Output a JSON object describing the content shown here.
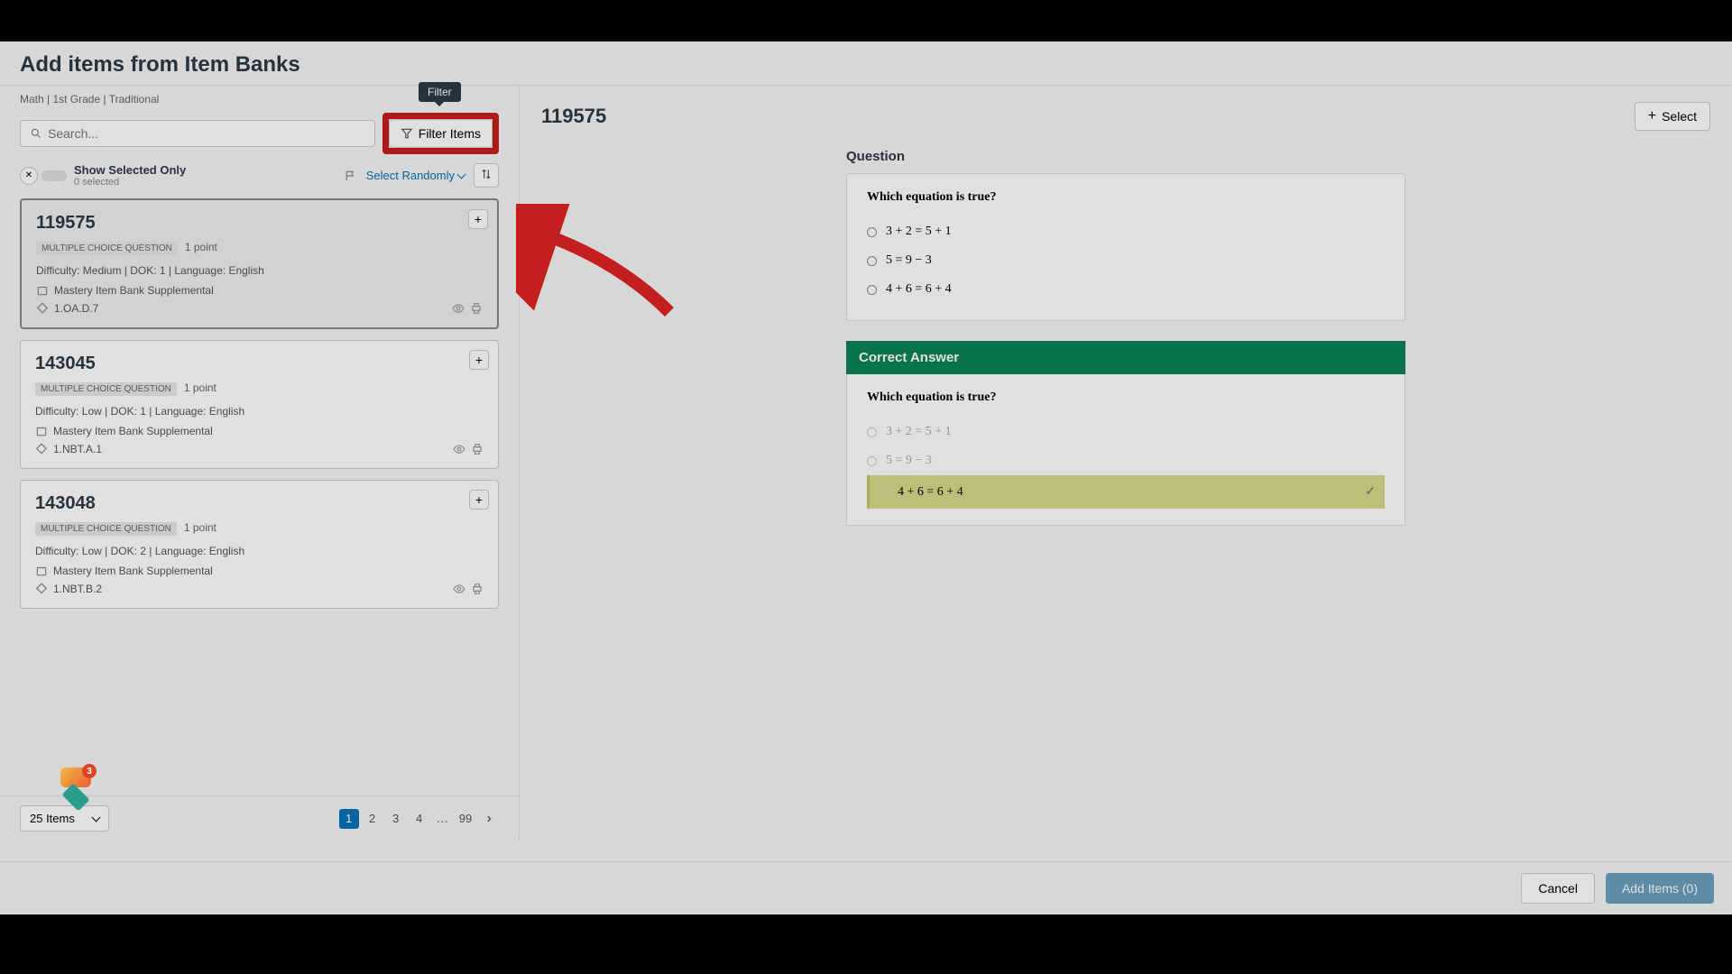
{
  "header": {
    "title": "Add items from Item Banks"
  },
  "breadcrumb": "Math | 1st Grade | Traditional",
  "tooltip": "Filter",
  "search": {
    "placeholder": "Search..."
  },
  "filter_button": "Filter Items",
  "show_selected": {
    "label": "Show Selected Only",
    "sub": "0 selected"
  },
  "select_randomly": "Select Randomly",
  "items": [
    {
      "id": "119575",
      "type": "MULTIPLE CHOICE QUESTION",
      "points": "1 point",
      "meta": "Difficulty: Medium  |  DOK: 1  |  Language: English",
      "bank": "Mastery Item Bank Supplemental",
      "standard": "1.OA.D.7",
      "selected": true
    },
    {
      "id": "143045",
      "type": "MULTIPLE CHOICE QUESTION",
      "points": "1 point",
      "meta": "Difficulty: Low  |  DOK: 1  |  Language: English",
      "bank": "Mastery Item Bank Supplemental",
      "standard": "1.NBT.A.1",
      "selected": false
    },
    {
      "id": "143048",
      "type": "MULTIPLE CHOICE QUESTION",
      "points": "1 point",
      "meta": "Difficulty: Low  |  DOK: 2  |  Language: English",
      "bank": "Mastery Item Bank Supplemental",
      "standard": "1.NBT.B.2",
      "selected": false
    }
  ],
  "per_page": "25 Items",
  "pages": {
    "active": "1",
    "p2": "2",
    "p3": "3",
    "p4": "4",
    "ell": "...",
    "last": "99"
  },
  "preview": {
    "id": "119575",
    "select": "Select",
    "question_label": "Question",
    "question_text": "Which equation is true?",
    "options": [
      "3 + 2 = 5 + 1",
      "5 = 9 − 3",
      "4 + 6 = 6 + 4"
    ],
    "correct_label": "Correct Answer",
    "correct_index": 2
  },
  "footer": {
    "cancel": "Cancel",
    "add": "Add Items (0)"
  },
  "badge_count": "3"
}
